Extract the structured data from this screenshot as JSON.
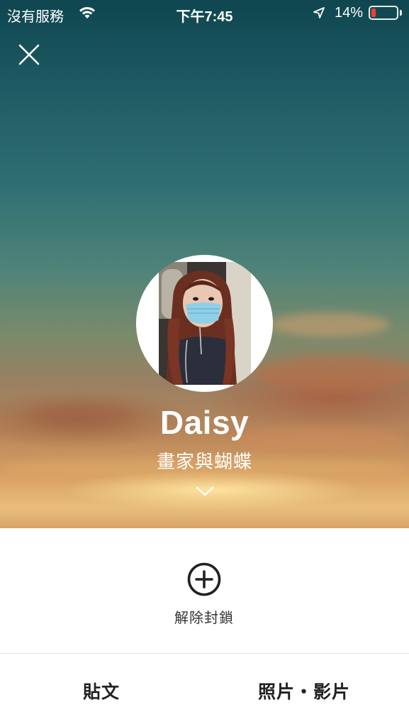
{
  "status_bar": {
    "carrier": "沒有服務",
    "time": "下午7:45",
    "battery": "14%",
    "wifi_icon": "wifi-icon",
    "location_icon": "location-arrow-icon",
    "battery_level": 0.14,
    "battery_color": "#ff3b30"
  },
  "header": {
    "close_icon": "close-icon"
  },
  "profile": {
    "name": "Daisy",
    "status_message": "畫家與蝴蝶",
    "expand_icon": "chevron-down-icon"
  },
  "actions": {
    "unblock_label": "解除封鎖",
    "unblock_icon": "plus-circle-icon"
  },
  "tabs": [
    {
      "label": "貼文"
    },
    {
      "label": "照片・影片"
    }
  ]
}
